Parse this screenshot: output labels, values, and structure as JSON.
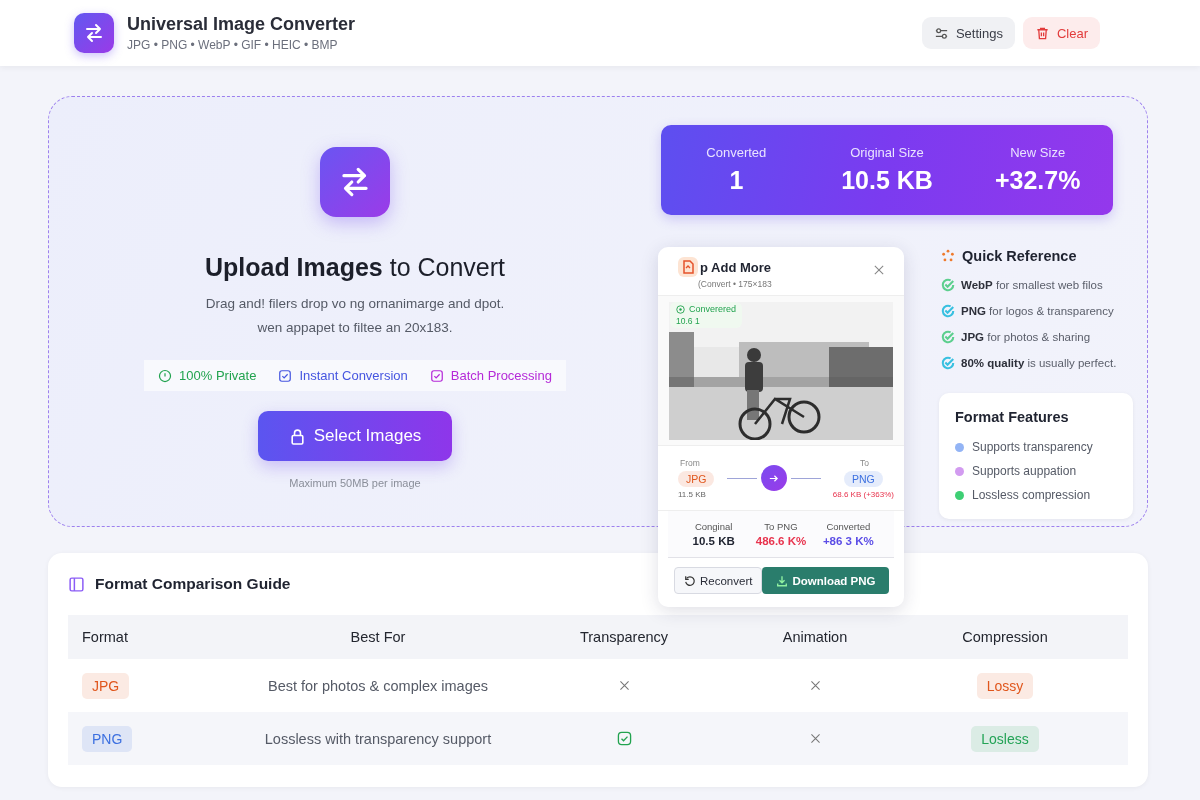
{
  "header": {
    "title": "Universal Image Converter",
    "subtitle": "JPG • PNG • WebP • GIF • HEIC • BMP",
    "buttons": [
      {
        "label": "Settings",
        "kind": "settings"
      },
      {
        "label": "Clear",
        "kind": "danger"
      }
    ]
  },
  "upload": {
    "title": "**Upload Images** to Convert",
    "description": [
      "Drag and! filers drop vo ng ornanimarge and dpot.",
      "wen appapet to filtee an 20x183."
    ],
    "features": [
      {
        "label": "100% Private",
        "kind": "clock",
        "color": "#22a34f"
      },
      {
        "label": "Instant Conversion",
        "kind": "check",
        "color": "#4656e0"
      },
      {
        "label": "Batch Processing",
        "kind": "check",
        "color": "#b52ad8"
      }
    ],
    "button": "Select Images",
    "note": "Maximum 50MB per image"
  },
  "stats": [
    {
      "label": "Converted",
      "value": "1"
    },
    {
      "label": "Original Size",
      "value": "10.5 KB"
    },
    {
      "label": "New Size",
      "value": "+32.7%"
    }
  ],
  "result_card": {
    "title": "p Add More",
    "subtitle": "(Convert • 175×183",
    "status": "Converered",
    "status_size": "10.6 1",
    "from": {
      "label": "From",
      "format": "JPG",
      "color": "#e0561c",
      "size": "11.5 KB"
    },
    "to": {
      "label": "To",
      "format": "PNG",
      "color": "#3b6fe0",
      "size": "68.6 KB (+363%)"
    },
    "stats": [
      {
        "label": "Conginal",
        "value": "10.5 KB",
        "color": "#1f2330"
      },
      {
        "label": "To PNG",
        "value": "486.6 K%",
        "color": "#e8344e"
      },
      {
        "label": "Converted",
        "value": "+86 3 K%",
        "color": "#5b4de6"
      }
    ],
    "buttons": [
      {
        "label": "Reconvert",
        "kind": "secondary"
      },
      {
        "label": "Download PNG",
        "kind": "primary"
      }
    ]
  },
  "quick_reference": {
    "title": "Quick Reference",
    "items": [
      {
        "text": "**WebP** for smallest web filos",
        "color": "#5ccf8e"
      },
      {
        "text": "**PNG** for logos & transparency",
        "color": "#38c0e0"
      },
      {
        "text": "**JPG** for photos & sharing",
        "color": "#5ccf8e"
      },
      {
        "text": "**80% quality** is usually perfect.",
        "color": "#38c0e0"
      }
    ]
  },
  "format_features": {
    "title": "Format Features",
    "items": [
      {
        "label": "Supports transparency",
        "color": "#93b4f5"
      },
      {
        "label": "Supports auppation",
        "color": "#d29bf0"
      },
      {
        "label": "Lossless compression",
        "color": "#3ecf74"
      }
    ]
  },
  "guide": {
    "title": "Format Comparison Guide",
    "columns": [
      "Format",
      "Best For",
      "Transparency",
      "Animation",
      "Compression"
    ],
    "rows": [
      {
        "format": {
          "label": "JPG",
          "color": "#e0561c"
        },
        "best_for": "Best for photos & complex images",
        "transparency": false,
        "animation": false,
        "compression": {
          "label": "Lossy",
          "color": "#e0561c"
        }
      },
      {
        "format": {
          "label": "PNG",
          "color": "#3b6fe0"
        },
        "best_for": "Lossless with transparency support",
        "transparency": true,
        "animation": false,
        "compression": {
          "label": "Losless",
          "color": "#23a356"
        }
      }
    ]
  }
}
